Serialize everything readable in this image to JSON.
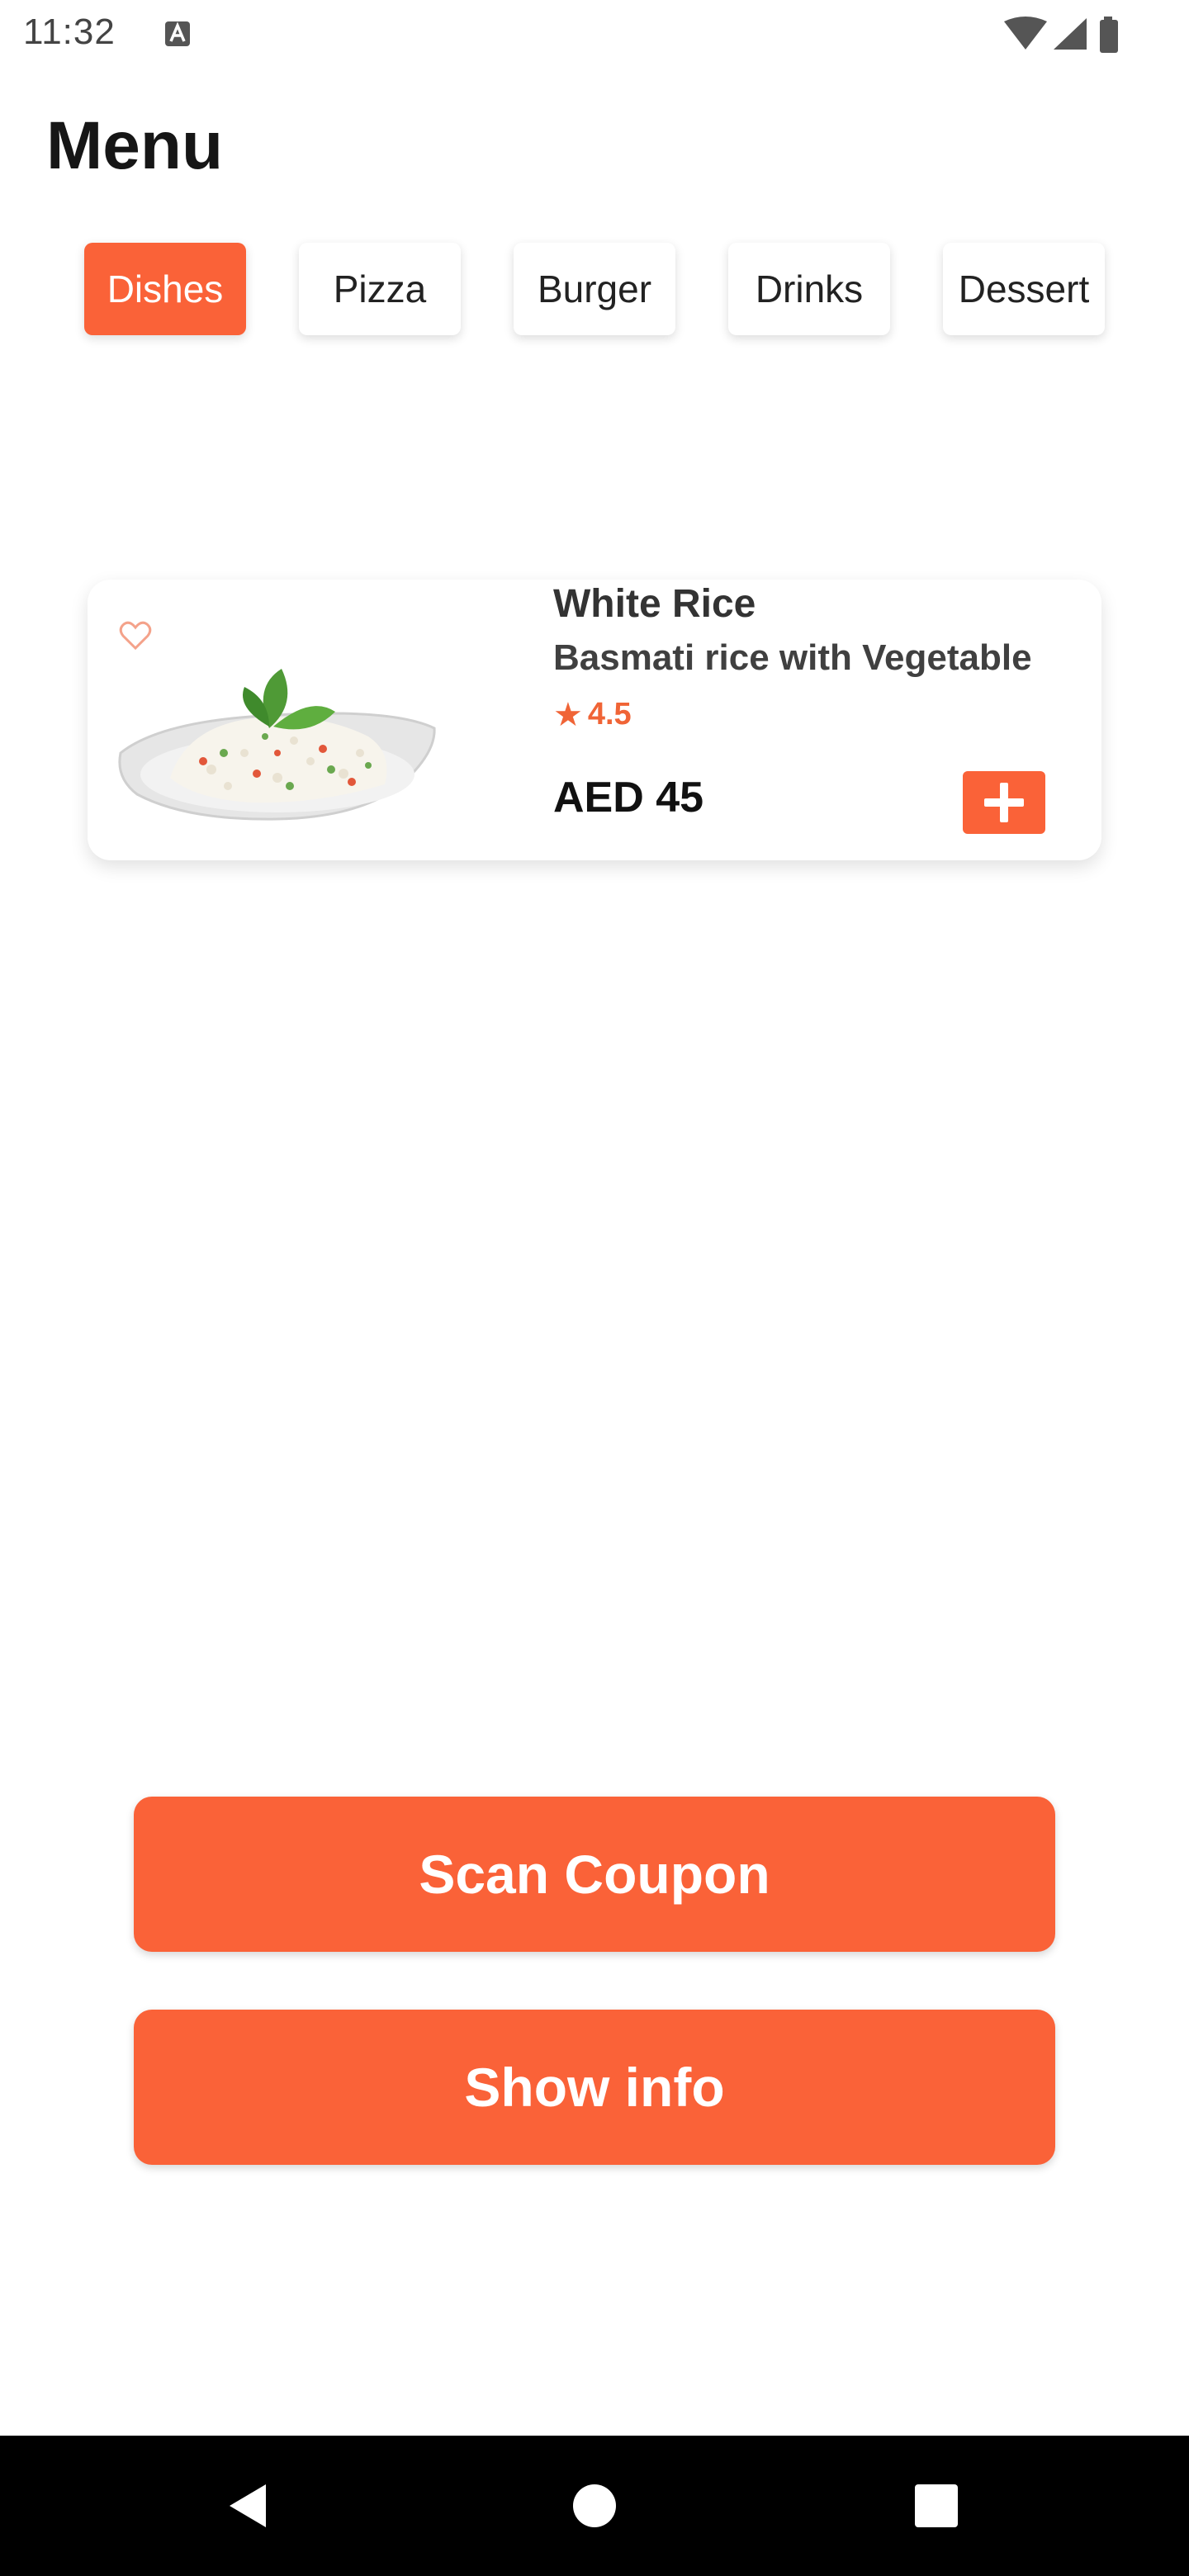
{
  "status_bar": {
    "time": "11:32",
    "icons": [
      "a-notification-icon",
      "wifi-icon",
      "signal-icon",
      "battery-icon"
    ]
  },
  "header": {
    "title": "Menu"
  },
  "categories": [
    {
      "label": "Dishes",
      "active": true
    },
    {
      "label": "Pizza",
      "active": false
    },
    {
      "label": "Burger",
      "active": false
    },
    {
      "label": "Drinks",
      "active": false
    },
    {
      "label": "Dessert",
      "active": false
    }
  ],
  "items": [
    {
      "name": "White Rice",
      "description": "Basmati rice with Vegetable",
      "rating": "4.5",
      "price": "AED 45",
      "icons": [
        "heart-icon",
        "plus-icon",
        "rating-star-icon"
      ]
    }
  ],
  "actions": {
    "scan_coupon": "Scan Coupon",
    "show_info": "Show info"
  },
  "nav": {
    "icons": [
      "back-icon",
      "home-icon",
      "recents-icon"
    ]
  },
  "colors": {
    "accent": "#fa6238",
    "title_text": "#161616",
    "nav_bar": "#000000",
    "background": "#ffffff"
  }
}
